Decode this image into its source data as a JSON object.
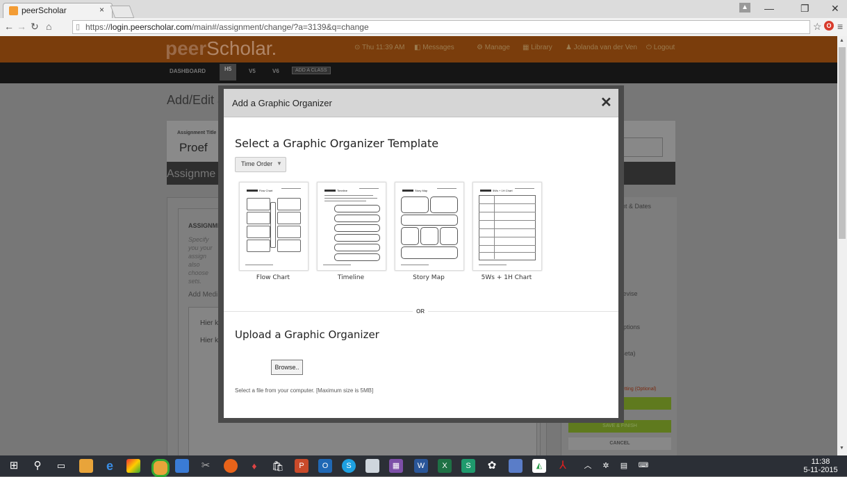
{
  "browser": {
    "tab_title": "peerScholar",
    "tab_close": "×",
    "url_prefix": "https://",
    "url_host": "login.peerscholar.com",
    "url_path": "/main#/assignment/change/?a=3139&q=change",
    "minimize": "—",
    "maximize": "❐",
    "close": "✕"
  },
  "app_header": {
    "logo_peer": "peer",
    "logo_scholar": "Scholar.",
    "time": "⊙ Thu 11:39 AM",
    "messages": "Messages",
    "manage": "Manage",
    "library": "Library",
    "user": "Jolanda van der Ven",
    "logout": "Logout"
  },
  "nav": {
    "dashboard": "DASHBOARD",
    "h5": "H5",
    "v5a": "V5",
    "v6": "V6",
    "add_class": "ADD A CLASS"
  },
  "background": {
    "page_title": "Add/Edit a",
    "assignment_title_label": "Assignment Title",
    "assignment_title_value": "Proef",
    "assignment_tab": "Assignme",
    "assign_label": "ASSIGNMI",
    "specify_text": "Specify you your assign also choose sets.",
    "add_media": "Add Medi",
    "hier1": "Hier ko",
    "hier2": "Hier ku",
    "right_dates": "ent & Dates",
    "right_revise": "Revise",
    "right_options": "Options",
    "right_beta": "(Beta)",
    "right_setting": "Setting (Optional)",
    "save_finish": "SAVE & FINISH",
    "cancel": "CANCEL"
  },
  "modal": {
    "title": "Add a Graphic Organizer",
    "close_glyph": "✕",
    "select_heading": "Select a Graphic Organizer Template",
    "dropdown_value": "Time Order",
    "templates": [
      {
        "label": "Flow Chart",
        "thumb_title": "Flow Chart"
      },
      {
        "label": "Timeline",
        "thumb_title": "Timeline"
      },
      {
        "label": "Story Map",
        "thumb_title": "Story Map"
      },
      {
        "label": "5Ws + 1H Chart",
        "thumb_title": "5Ws + 1H Chart"
      }
    ],
    "or_text": "OR",
    "upload_heading": "Upload a Graphic Organizer",
    "browse_button": "Browse..",
    "hint": "Select a file from your computer. [Maximum size is 5MB]"
  },
  "taskbar": {
    "time": "11:38",
    "date": "5-11-2015"
  }
}
